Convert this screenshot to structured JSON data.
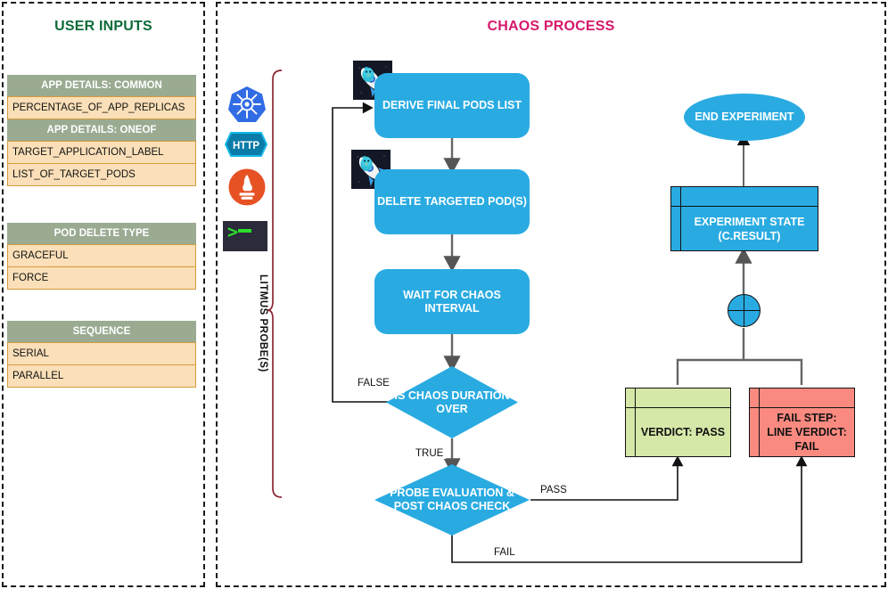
{
  "left_panel": {
    "title": "USER INPUTS",
    "tables": [
      {
        "name": "app-details",
        "sections": [
          {
            "header": "APP DETAILS: COMMON",
            "rows": [
              "PERCENTAGE_OF_APP_REPLICAS"
            ]
          },
          {
            "header": "APP DETAILS: ONEOF",
            "rows": [
              "TARGET_APPLICATION_LABEL",
              "LIST_OF_TARGET_PODS"
            ]
          }
        ]
      },
      {
        "name": "pod-delete-type",
        "sections": [
          {
            "header": "POD DELETE TYPE",
            "rows": [
              "GRACEFUL",
              "FORCE"
            ]
          }
        ]
      },
      {
        "name": "sequence",
        "sections": [
          {
            "header": "SEQUENCE",
            "rows": [
              "SERIAL",
              "PARALLEL"
            ]
          }
        ]
      }
    ]
  },
  "right_panel": {
    "title": "CHAOS PROCESS"
  },
  "probes": {
    "bracket_label": "LITMUS PROBE(S)",
    "icons": [
      {
        "name": "kubernetes-probe-icon",
        "label": "Kubernetes"
      },
      {
        "name": "http-probe-icon",
        "label": "HTTP"
      },
      {
        "name": "prometheus-probe-icon",
        "label": "Prometheus"
      },
      {
        "name": "cmd-probe-icon",
        "label": ">_"
      }
    ]
  },
  "flow": {
    "nodes": {
      "derive_final_pods_list": "DERIVE FINAL PODS LIST",
      "delete_targeted_pods": "DELETE TARGETED POD(S)",
      "wait_for_chaos_interval": "WAIT FOR CHAOS INTERVAL",
      "is_chaos_duration_over": "IS CHAOS DURATION OVER",
      "probe_evaluation": "PROBE EVALUATION & POST CHAOS CHECK",
      "end_experiment": "END EXPERIMENT",
      "experiment_state": "EXPERIMENT STATE (C.RESULT)",
      "verdict_pass": "VERDICT: PASS",
      "verdict_fail": "FAIL STEP: LINE VERDICT: FAIL"
    },
    "edge_labels": {
      "false": "FALSE",
      "true": "TRUE",
      "pass": "PASS",
      "fail": "FAIL"
    }
  },
  "colors": {
    "accent_blue": "#29abe2",
    "title_green": "#0d6b37",
    "title_magenta": "#d6186b",
    "table_header": "#9aab92",
    "table_row": "#fadfb8",
    "table_row_border": "#d79b3c",
    "pass_green": "#d5e8a8",
    "fail_red": "#fa8a80",
    "bracket": "#8b2633"
  }
}
